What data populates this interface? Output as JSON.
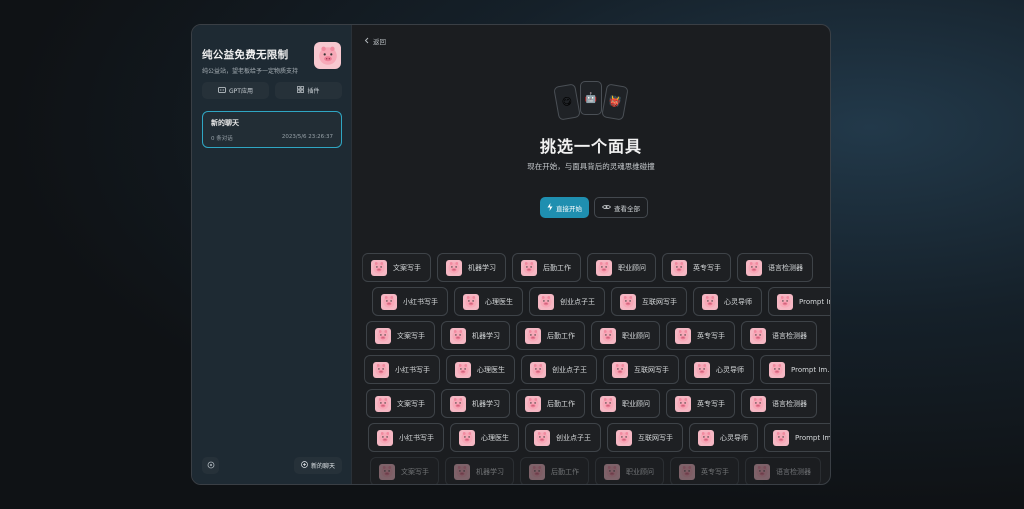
{
  "sidebar": {
    "title": "纯公益免费无限制",
    "subtitle": "纯公益站，望老板给予一定物质支持",
    "buttons": {
      "gpt_apps": "GPT应用",
      "plugins": "插件"
    },
    "chat": {
      "title": "新的聊天",
      "count": "0 条对话",
      "time": "2023/5/6 23:26:37"
    },
    "new_chat": "新的聊天"
  },
  "main": {
    "back": "返回",
    "mask_emojis": [
      "😋",
      "🤖",
      "👹"
    ],
    "title": "挑选一个面具",
    "subtitle": "现在开始，与面具背后的灵魂思维碰撞",
    "start_button": "直接开始",
    "view_all_button": "查看全部"
  },
  "masks": {
    "row_a": [
      "文案写手",
      "机器学习",
      "后勤工作",
      "职业顾问",
      "英专写手",
      "语言检测器"
    ],
    "row_b": [
      "小红书写手",
      "心理医生",
      "创业点子王",
      "互联网写手",
      "心灵导师",
      "Prompt Im..."
    ]
  },
  "colors": {
    "accent": "#1f8fb0",
    "sidebar": "#1e2a33",
    "pig": "#f5b7c3"
  }
}
